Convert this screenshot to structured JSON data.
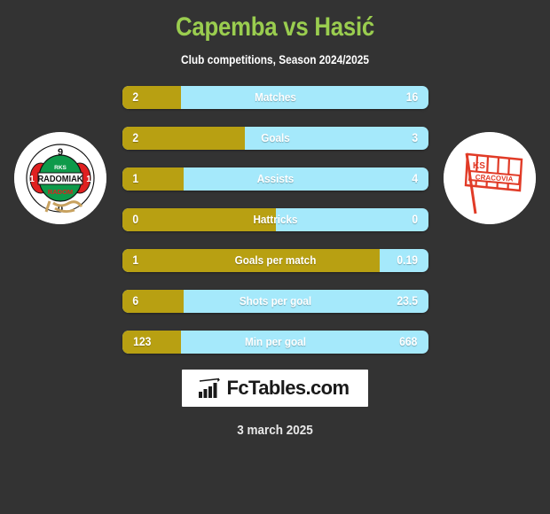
{
  "header": {
    "title": "Capemba vs Hasić",
    "subtitle": "Club competitions, Season 2024/2025"
  },
  "teams": {
    "home": {
      "badge_name": "radomiak-radom-crest",
      "crest_text": {
        "club_short": "RKS",
        "club_name": "RADOMIAK",
        "city": "RADOM",
        "year_top": "9",
        "year_left": "1",
        "year_right": "1",
        "year_bottom": "0"
      },
      "colors": {
        "green": "#0E9A4A",
        "red": "#E02020",
        "white": "#FFFFFF"
      }
    },
    "away": {
      "badge_name": "cracovia-crest",
      "crest_text": {
        "club_short": "KS",
        "club_name": "CRACOVIA"
      },
      "colors": {
        "red": "#E13B27",
        "white": "#FFFFFF"
      }
    }
  },
  "colors": {
    "background": "#333333",
    "title": "#9ACD4F",
    "bar_home": "#B8A012",
    "bar_away": "#A5E9FB",
    "text": "#FFFFFF"
  },
  "chart_data": {
    "type": "bar",
    "title": "Capemba vs Hasić",
    "subtitle": "Club competitions, Season 2024/2025",
    "orientation": "horizontal-diverging",
    "categories": [
      "Matches",
      "Goals",
      "Assists",
      "Hattricks",
      "Goals per match",
      "Shots per goal",
      "Min per goal"
    ],
    "series": [
      {
        "name": "Capemba",
        "side": "home",
        "color": "#B8A012",
        "values": [
          "2",
          "2",
          "1",
          "0",
          "1",
          "6",
          "123"
        ]
      },
      {
        "name": "Hasić",
        "side": "away",
        "color": "#A5E9FB",
        "values": [
          "16",
          "3",
          "4",
          "0",
          "0.19",
          "23.5",
          "668"
        ]
      }
    ],
    "fill_percent_home": [
      19,
      40,
      20,
      50,
      84,
      20,
      19
    ]
  },
  "stats": [
    {
      "label": "Matches",
      "home": "2",
      "away": "16",
      "home_pct": 19
    },
    {
      "label": "Goals",
      "home": "2",
      "away": "3",
      "home_pct": 40
    },
    {
      "label": "Assists",
      "home": "1",
      "away": "4",
      "home_pct": 20
    },
    {
      "label": "Hattricks",
      "home": "0",
      "away": "0",
      "home_pct": 50
    },
    {
      "label": "Goals per match",
      "home": "1",
      "away": "0.19",
      "home_pct": 84
    },
    {
      "label": "Shots per goal",
      "home": "6",
      "away": "23.5",
      "home_pct": 20
    },
    {
      "label": "Min per goal",
      "home": "123",
      "away": "668",
      "home_pct": 19
    }
  ],
  "footer": {
    "logo_text": "FcTables.com",
    "logo_icon": "bar-chart-icon",
    "date": "3 march 2025"
  }
}
